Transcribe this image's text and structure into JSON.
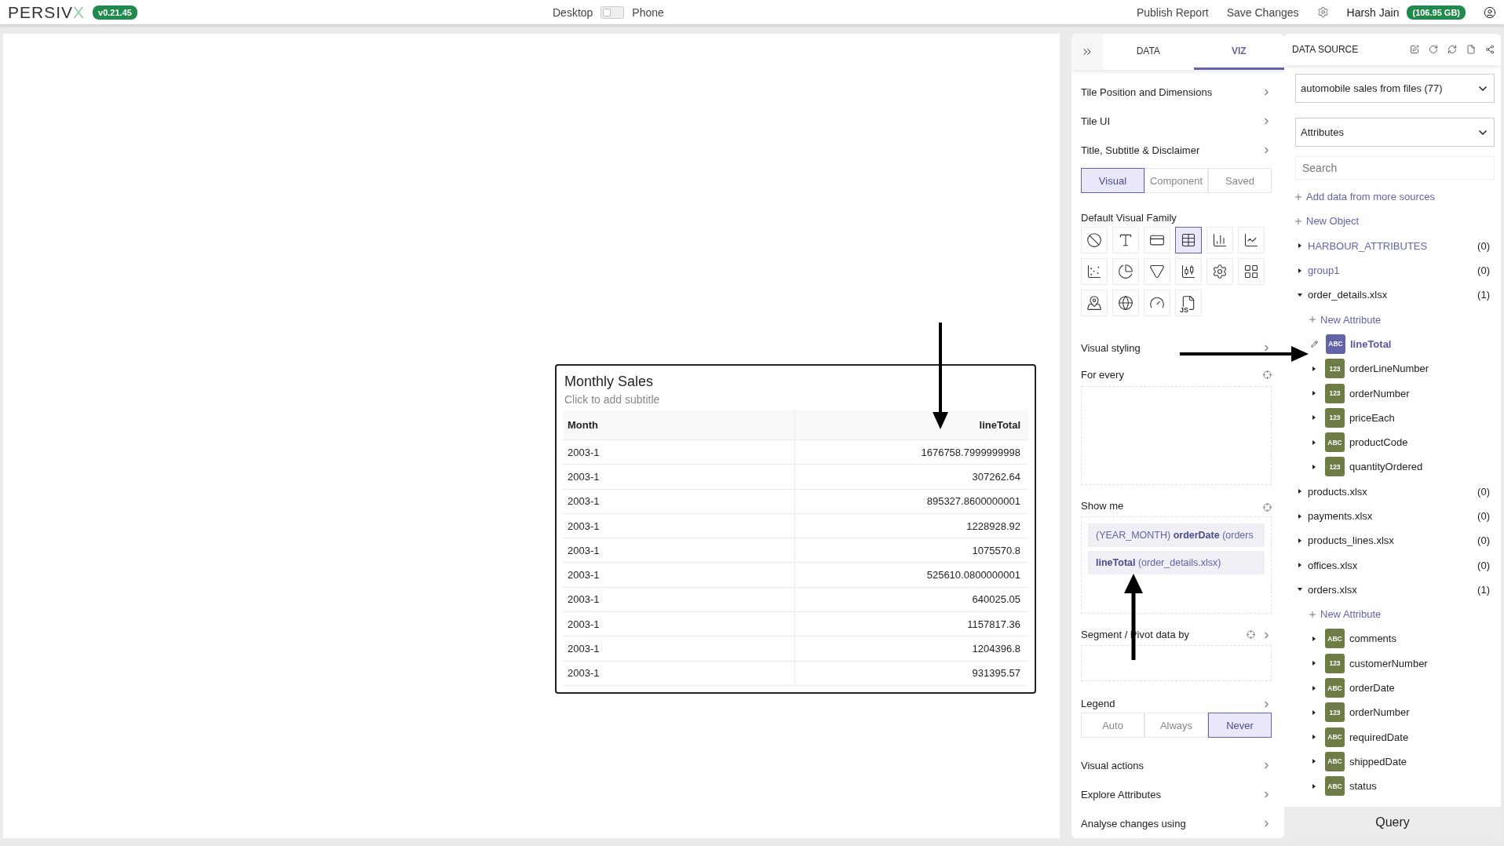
{
  "topbar": {
    "logo": "PERSIV",
    "logo_accent": "X",
    "version": "v0.21.45",
    "mode_left": "Desktop",
    "mode_right": "Phone",
    "phone_mode": false,
    "actions": [
      "Publish Report",
      "Save Changes"
    ],
    "user": "Harsh Jain",
    "storage": "(106.95 GB)"
  },
  "tile": {
    "title": "Monthly Sales",
    "subtitle": "Click to add subtitle",
    "columns": [
      "Month",
      "lineTotal"
    ],
    "rows": [
      [
        "2003-1",
        "1676758.7999999998"
      ],
      [
        "2003-1",
        "307262.64"
      ],
      [
        "2003-1",
        "895327.8600000001"
      ],
      [
        "2003-1",
        "1228928.92"
      ],
      [
        "2003-1",
        "1075570.8"
      ],
      [
        "2003-1",
        "525610.0800000001"
      ],
      [
        "2003-1",
        "640025.05"
      ],
      [
        "2003-1",
        "1157817.36"
      ],
      [
        "2003-1",
        "1204396.8"
      ],
      [
        "2003-1",
        "931395.57"
      ]
    ]
  },
  "viz_panel": {
    "tabs": [
      {
        "label": "DATA",
        "selected": false
      },
      {
        "label": "VIZ",
        "selected": true
      }
    ],
    "sections": [
      "Tile Position and Dimensions",
      "Tile UI",
      "Title, Subtitle & Disclaimer"
    ],
    "family_tabs": [
      {
        "label": "Visual",
        "selected": true
      },
      {
        "label": "Component",
        "selected": false
      },
      {
        "label": "Saved",
        "selected": false
      }
    ],
    "family_title": "Default Visual Family",
    "visual_types": [
      {
        "kind": "none",
        "selected": false
      },
      {
        "kind": "text",
        "selected": false
      },
      {
        "kind": "card",
        "selected": false
      },
      {
        "kind": "table",
        "selected": true
      },
      {
        "kind": "bar",
        "selected": false
      },
      {
        "kind": "line",
        "selected": false
      },
      {
        "kind": "scatter",
        "selected": false
      },
      {
        "kind": "pie",
        "selected": false
      },
      {
        "kind": "funnel",
        "selected": false
      },
      {
        "kind": "candlestick",
        "selected": false
      },
      {
        "kind": "gear",
        "selected": false
      },
      {
        "kind": "grid",
        "selected": false
      },
      {
        "kind": "map",
        "selected": false
      },
      {
        "kind": "globe",
        "selected": false
      },
      {
        "kind": "gauge",
        "selected": false
      },
      {
        "kind": "script",
        "label": "JS",
        "selected": false
      }
    ],
    "styling": "Visual styling",
    "for_every": "For every",
    "show_me": {
      "label": "Show me",
      "items": [
        "(YEAR_MONTH) **orderDate** (orders",
        "**lineTotal** (order_details.xlsx)"
      ]
    },
    "segment": "Segment / Pivot data by",
    "legend": {
      "label": "Legend",
      "options": [
        {
          "label": "Auto",
          "selected": false
        },
        {
          "label": "Always",
          "selected": false
        },
        {
          "label": "Never",
          "selected": true
        }
      ]
    },
    "more_sections": [
      "Visual actions",
      "Explore Attributes",
      "Analyse changes using"
    ]
  },
  "data_panel": {
    "title": "DATA SOURCE",
    "source": "automobile sales from files (77)",
    "view": "Attributes",
    "search_placeholder": "Search",
    "links": [
      "Add data from more sources",
      "New Object"
    ],
    "tree": [
      {
        "name": "HARBOUR_ATTRIBUTES",
        "kind": "object",
        "count": "(0)",
        "expanded": false
      },
      {
        "name": "group1",
        "kind": "object",
        "count": "(0)",
        "expanded": false
      },
      {
        "name": "order_details.xlsx",
        "kind": "file",
        "count": "(1)",
        "expanded": true,
        "new_attribute": "New Attribute",
        "children": [
          {
            "name": "lineTotal",
            "badge": "ABC",
            "selected": true
          },
          {
            "name": "orderLineNumber",
            "badge": "123",
            "selected": false
          },
          {
            "name": "orderNumber",
            "badge": "123",
            "selected": false
          },
          {
            "name": "priceEach",
            "badge": "123",
            "selected": false
          },
          {
            "name": "productCode",
            "badge": "ABC",
            "selected": false
          },
          {
            "name": "quantityOrdered",
            "badge": "123",
            "selected": false
          }
        ]
      },
      {
        "name": "products.xlsx",
        "kind": "file",
        "count": "(0)",
        "expanded": false
      },
      {
        "name": "payments.xlsx",
        "kind": "file",
        "count": "(0)",
        "expanded": false
      },
      {
        "name": "products_lines.xlsx",
        "kind": "file",
        "count": "(0)",
        "expanded": false
      },
      {
        "name": "offices.xlsx",
        "kind": "file",
        "count": "(0)",
        "expanded": false
      },
      {
        "name": "orders.xlsx",
        "kind": "file",
        "count": "(1)",
        "expanded": true,
        "new_attribute": "New Attribute",
        "children": [
          {
            "name": "comments",
            "badge": "ABC",
            "selected": false
          },
          {
            "name": "customerNumber",
            "badge": "123",
            "selected": false
          },
          {
            "name": "orderDate",
            "badge": "ABC",
            "selected": false
          },
          {
            "name": "orderNumber",
            "badge": "123",
            "selected": false
          },
          {
            "name": "requiredDate",
            "badge": "ABC",
            "selected": false
          },
          {
            "name": "shippedDate",
            "badge": "ABC",
            "selected": false
          },
          {
            "name": "status",
            "badge": "ABC",
            "selected": false
          }
        ]
      }
    ],
    "query": "Query"
  }
}
